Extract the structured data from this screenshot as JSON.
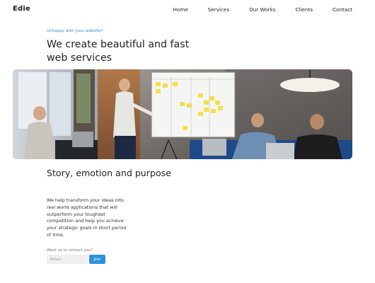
{
  "brand": {
    "logo": "Edie"
  },
  "nav": {
    "items": [
      {
        "label": "Home"
      },
      {
        "label": "Services"
      },
      {
        "label": "Our Works"
      },
      {
        "label": "Clients"
      },
      {
        "label": "Contact"
      }
    ]
  },
  "hero": {
    "eyebrow": "Unhappy with your website?",
    "title": "We create beautiful and fast web services"
  },
  "story": {
    "title": "Story, emotion and purpose",
    "body": "We help transform your ideas into real world applications that will outperform your toughest competition and help you achieve your strategic goals in short period of time."
  },
  "contact": {
    "label": "Want us to contact you?",
    "email_placeholder": "Email",
    "join_label": "Join"
  },
  "colors": {
    "accent": "#2d92db",
    "eyebrow": "#2a8ad4",
    "text": "#222222",
    "input_bg": "#efefef"
  }
}
